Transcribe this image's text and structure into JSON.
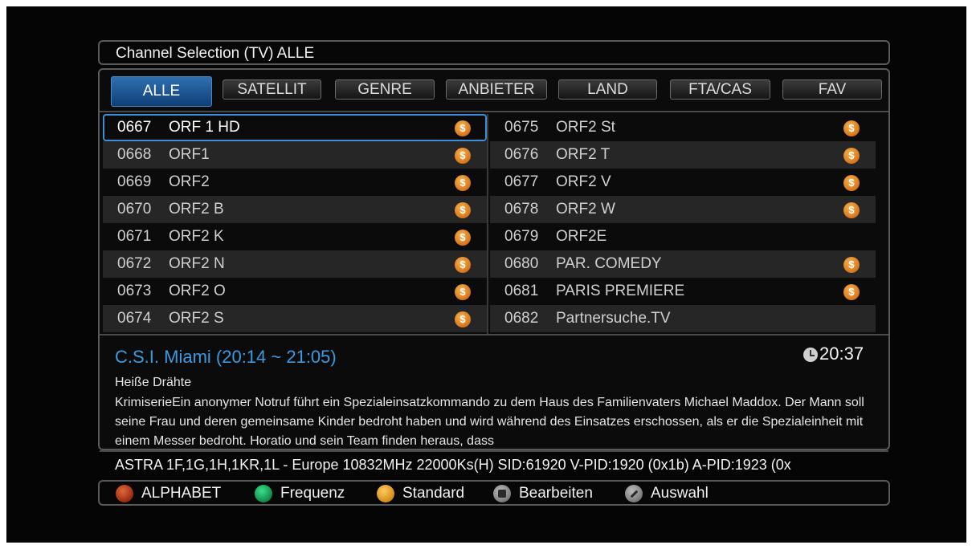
{
  "title": "Channel Selection (TV) ALLE",
  "tabs": [
    {
      "label": "ALLE",
      "active": true
    },
    {
      "label": "SATELLIT"
    },
    {
      "label": "GENRE"
    },
    {
      "label": "ANBIETER"
    },
    {
      "label": "LAND"
    },
    {
      "label": "FTA/CAS"
    },
    {
      "label": "FAV"
    }
  ],
  "channels_left": [
    {
      "num": "0667",
      "name": "ORF 1 HD",
      "icon": "$"
    },
    {
      "num": "0668",
      "name": "ORF1",
      "icon": "$"
    },
    {
      "num": "0669",
      "name": "ORF2",
      "icon": "$"
    },
    {
      "num": "0670",
      "name": "ORF2 B",
      "icon": "$"
    },
    {
      "num": "0671",
      "name": "ORF2 K",
      "icon": "$"
    },
    {
      "num": "0672",
      "name": "ORF2 N",
      "icon": "$"
    },
    {
      "num": "0673",
      "name": "ORF2 O",
      "icon": "$"
    },
    {
      "num": "0674",
      "name": "ORF2 S",
      "icon": "$"
    }
  ],
  "channels_right": [
    {
      "num": "0675",
      "name": "ORF2 St",
      "icon": "$"
    },
    {
      "num": "0676",
      "name": "ORF2 T",
      "icon": "$"
    },
    {
      "num": "0677",
      "name": "ORF2 V",
      "icon": "$"
    },
    {
      "num": "0678",
      "name": "ORF2 W",
      "icon": "$"
    },
    {
      "num": "0679",
      "name": "ORF2E",
      "icon": ""
    },
    {
      "num": "0680",
      "name": "PAR. COMEDY",
      "icon": "$"
    },
    {
      "num": "0681",
      "name": "PARIS PREMIERE",
      "icon": "$"
    },
    {
      "num": "0682",
      "name": "Partnersuche.TV",
      "icon": ""
    }
  ],
  "program": {
    "title": "C.S.I. Miami (20:14 ~ 21:05)",
    "subtitle": "Heiße Drähte",
    "description": "KrimiserieEin anonymer Notruf führt ein Spezialeinsatzkommando zu dem Haus des Familienvaters Michael Maddox. Der Mann soll seine Frau und deren gemeinsame Kinder bedroht haben und wird während des Einsatzes erschossen, als er die Spezialeinheit mit einem Messer bedroht. Horatio und sein Team finden heraus, dass",
    "clock": "20:37"
  },
  "transponder": "ASTRA 1F,1G,1H,1KR,1L - Europe 10832MHz 22000Ks(H) SID:61920 V-PID:1920 (0x1b) A-PID:1923 (0x",
  "footer": [
    {
      "label": "ALPHABET",
      "icon": "red-button-icon"
    },
    {
      "label": "Frequenz",
      "icon": "green-button-icon"
    },
    {
      "label": "Standard",
      "icon": "yellow-button-icon"
    },
    {
      "label": "Bearbeiten",
      "icon": "menu-button-icon"
    },
    {
      "label": "Auswahl",
      "icon": "edit-button-icon"
    }
  ],
  "colors": {
    "accent": "#3c9be0",
    "coin": "#d7741b"
  }
}
